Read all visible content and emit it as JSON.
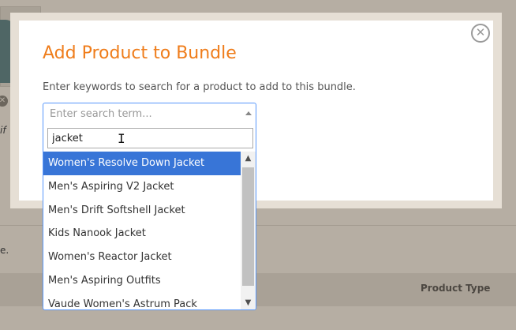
{
  "background": {
    "partial_text_1": "if",
    "partial_text_2": "e.",
    "remove_glyph": "✕",
    "column_header": "Product Type"
  },
  "modal": {
    "title": "Add Product to Bundle",
    "description": "Enter keywords to search for a product to add to this bundle.",
    "close_glyph": "✕",
    "select": {
      "placeholder": "Enter search term...",
      "search_value": "jacket",
      "results": [
        "Women's Resolve Down Jacket",
        "Men's Aspiring V2 Jacket",
        "Men's Drift Softshell Jacket",
        "Kids Nanook Jacket",
        "Women's Reactor Jacket",
        "Men's Aspiring Outfits",
        "Vaude Women's Astrum Pack"
      ],
      "highlighted_result": "Women's Resolve Down Jacket",
      "scroll_up_glyph": "▲",
      "scroll_down_glyph": "▼"
    }
  },
  "colors": {
    "title_orange": "#ef7d1b",
    "highlight_blue": "#3875d7",
    "focus_border": "#5897fb",
    "overlay": "#b6aea3"
  }
}
